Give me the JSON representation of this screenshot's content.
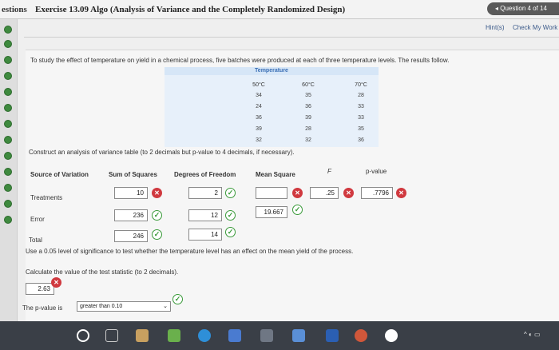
{
  "nav_label": "estions",
  "exercise_title": "Exercise 13.09 Algo (Analysis of Variance and the Completely Randomized Design)",
  "question_pill": "Question 4 of 14",
  "toolbar": {
    "hints": "Hint(s)",
    "check_work": "Check My Work"
  },
  "prompt": "To study the effect of temperature on yield in a chemical process, five batches were produced at each of three temperature levels. The results follow.",
  "data_table": {
    "group_title": "Temperature",
    "columns": [
      "50°C",
      "60°C",
      "70°C"
    ],
    "rows": [
      [
        "34",
        "35",
        "28"
      ],
      [
        "24",
        "36",
        "33"
      ],
      [
        "36",
        "39",
        "33"
      ],
      [
        "39",
        "28",
        "35"
      ],
      [
        "32",
        "32",
        "36"
      ]
    ]
  },
  "anova_instruction": "Construct an analysis of variance table (to 2 decimals but p-value to 4 decimals, if necessary).",
  "anova": {
    "headers": [
      "Source of Variation",
      "Sum of Squares",
      "Degrees of Freedom",
      "Mean Square",
      "F",
      "p-value"
    ],
    "treatments": {
      "label": "Treatments",
      "ss": "10",
      "df": "2",
      "ms": "",
      "f": ".25",
      "p": ".7796"
    },
    "error": {
      "label": "Error",
      "ss": "236",
      "df": "12",
      "ms": "19.667"
    },
    "total": {
      "label": "Total",
      "ss": "246",
      "df": "14"
    }
  },
  "q_significance": "Use a 0.05 level of significance to test whether the temperature level has an effect on the mean yield of the process.",
  "q_test_stat": "Calculate the value of the test statistic (to 2 decimals).",
  "test_stat_value": "2.63",
  "pvalue_prefix": "The p-value is",
  "pvalue_selected": "greater than 0.10",
  "colors": {
    "correct": "#3a9a3a",
    "incorrect": "#d0393f",
    "accent": "#3a6fb5",
    "taskbar": "#3a3f47"
  },
  "taskbar_icons": [
    "start-icon",
    "task-view-icon",
    "file-explorer-icon",
    "edge-icon",
    "store-icon",
    "calendar-icon",
    "chrome-icon",
    "word-icon",
    "google-icon"
  ]
}
